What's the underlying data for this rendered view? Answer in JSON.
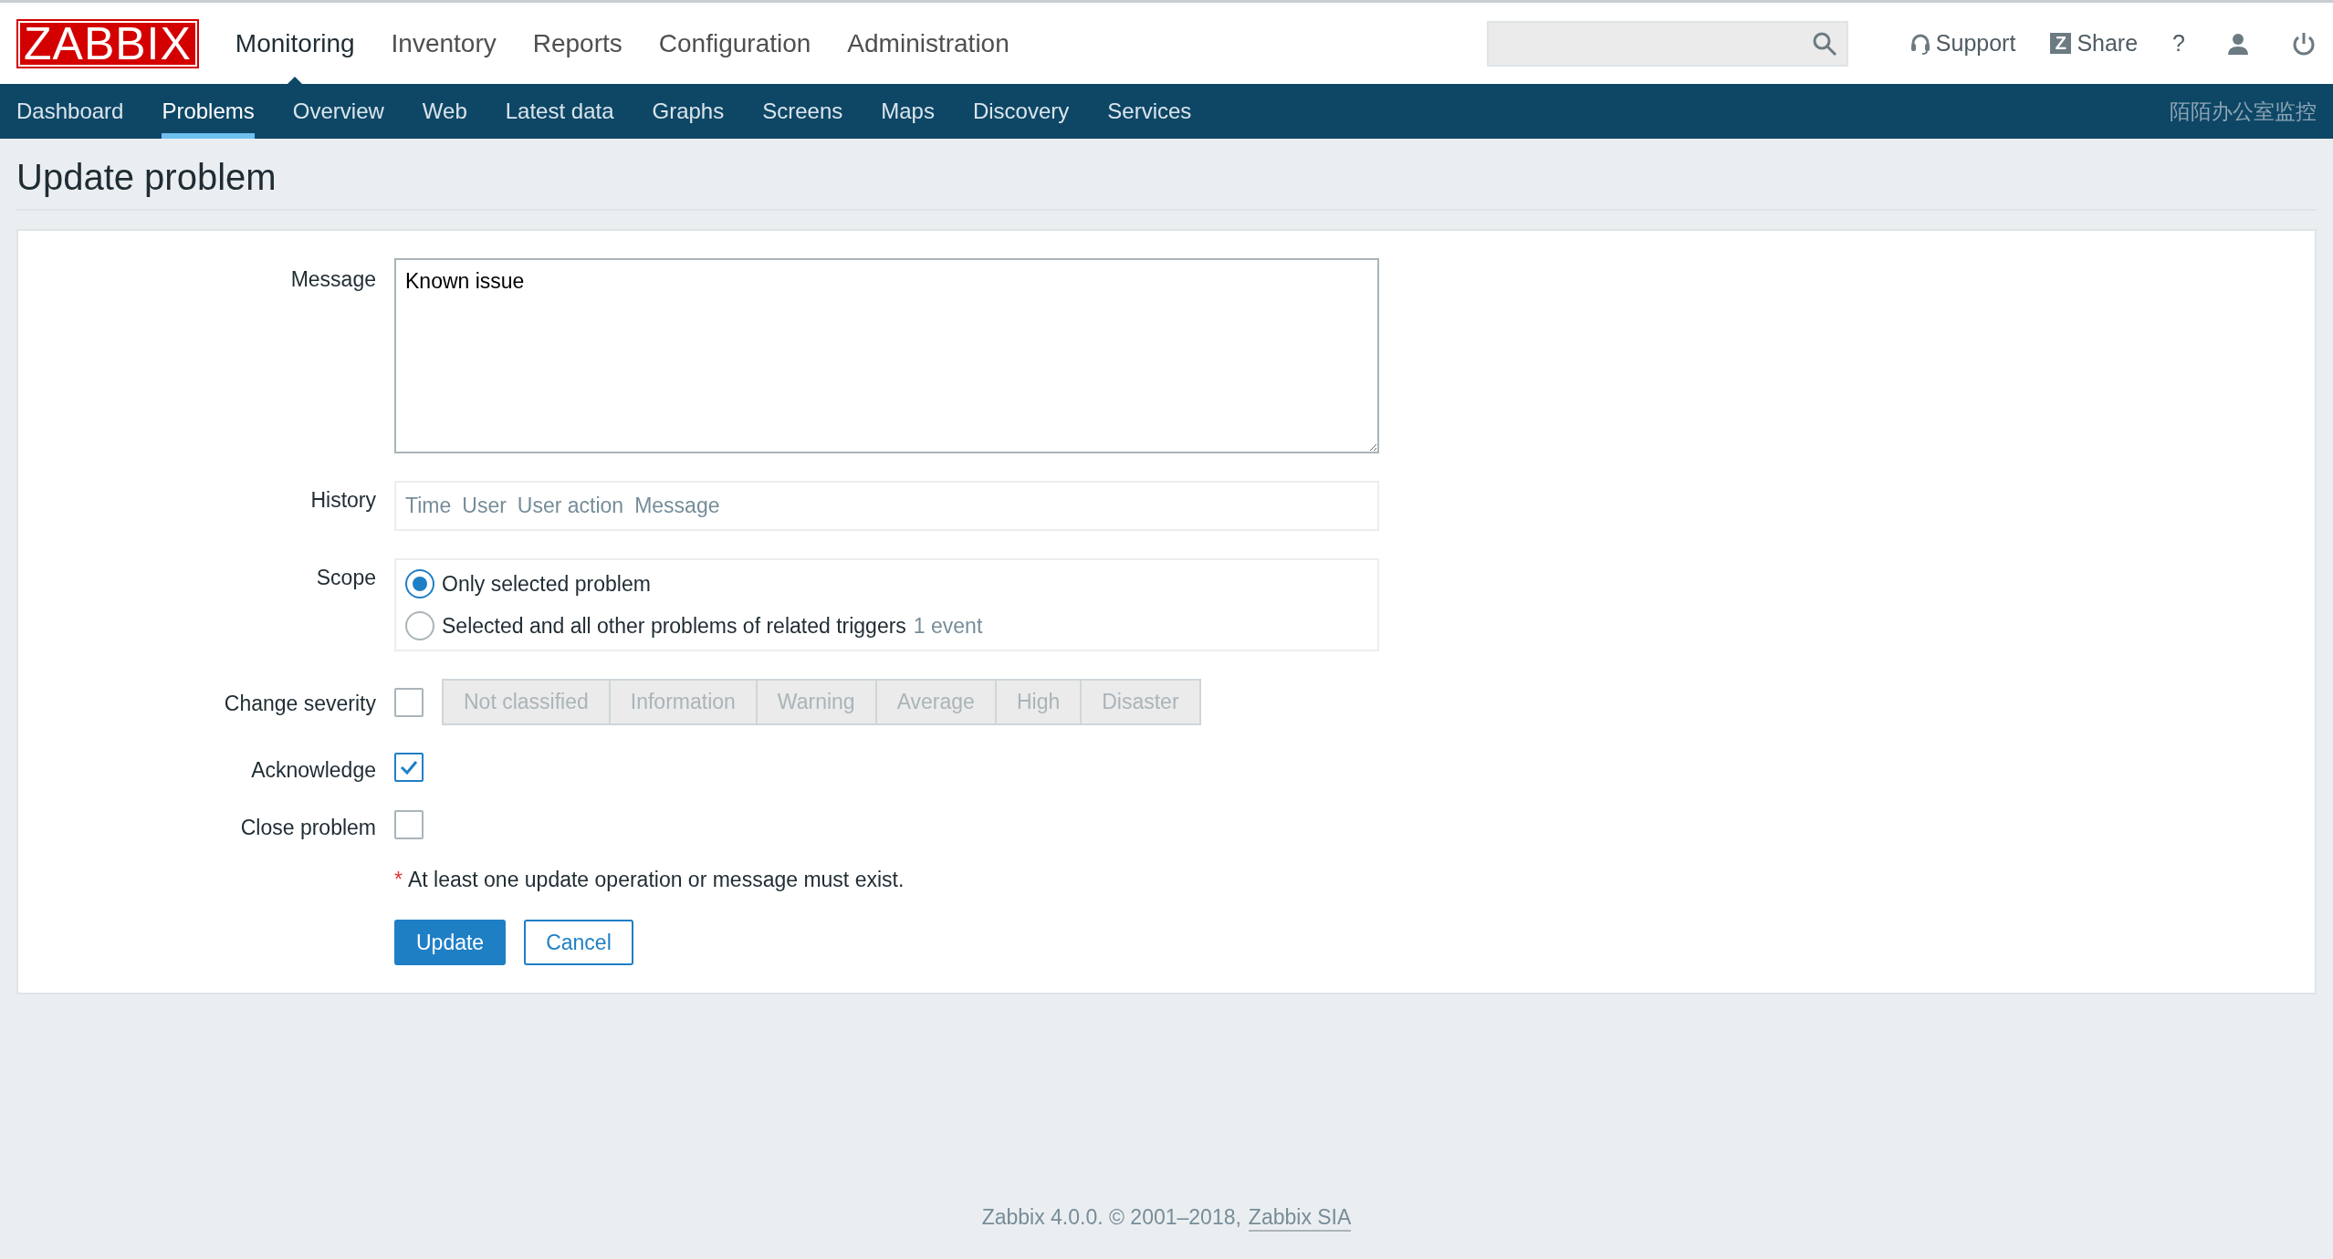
{
  "logo": "ZABBIX",
  "main_menu": [
    {
      "label": "Monitoring",
      "selected": true
    },
    {
      "label": "Inventory",
      "selected": false
    },
    {
      "label": "Reports",
      "selected": false
    },
    {
      "label": "Configuration",
      "selected": false
    },
    {
      "label": "Administration",
      "selected": false
    }
  ],
  "header_links": [
    {
      "kind": "support",
      "label": "Support"
    },
    {
      "kind": "share",
      "label": "Share",
      "icon_letter": "Z"
    },
    {
      "kind": "help",
      "label": "?"
    },
    {
      "kind": "user"
    },
    {
      "kind": "logout"
    }
  ],
  "sub_menu": [
    {
      "label": "Dashboard",
      "selected": false
    },
    {
      "label": "Problems",
      "selected": true
    },
    {
      "label": "Overview",
      "selected": false
    },
    {
      "label": "Web",
      "selected": false
    },
    {
      "label": "Latest data",
      "selected": false
    },
    {
      "label": "Graphs",
      "selected": false
    },
    {
      "label": "Screens",
      "selected": false
    },
    {
      "label": "Maps",
      "selected": false
    },
    {
      "label": "Discovery",
      "selected": false
    },
    {
      "label": "Services",
      "selected": false
    }
  ],
  "server_name": "陌陌办公室监控",
  "page_title": "Update problem",
  "form": {
    "message": {
      "label": "Message",
      "value": "Known issue"
    },
    "history": {
      "label": "History",
      "columns": [
        "Time",
        "User",
        "User action",
        "Message"
      ]
    },
    "scope": {
      "label": "Scope",
      "options": [
        {
          "label": "Only selected problem",
          "selected": true
        },
        {
          "label": "Selected and all other problems of related triggers",
          "selected": false,
          "note": "1 event"
        }
      ]
    },
    "checks": [
      {
        "kind": "severity",
        "label": "Change severity",
        "checked": false,
        "disabled": true,
        "severities": [
          "Not classified",
          "Information",
          "Warning",
          "Average",
          "High",
          "Disaster"
        ]
      },
      {
        "kind": "plain",
        "label": "Acknowledge",
        "checked": true
      },
      {
        "kind": "plain",
        "label": "Close problem",
        "checked": false
      }
    ],
    "required_mark": "*",
    "hint": "At least one update operation or message must exist.",
    "buttons": [
      {
        "label": "Update",
        "kind": "primary"
      },
      {
        "label": "Cancel",
        "kind": "secondary"
      }
    ]
  },
  "footer": {
    "text": "Zabbix 4.0.0. © 2001–2018,",
    "link": "Zabbix SIA"
  }
}
